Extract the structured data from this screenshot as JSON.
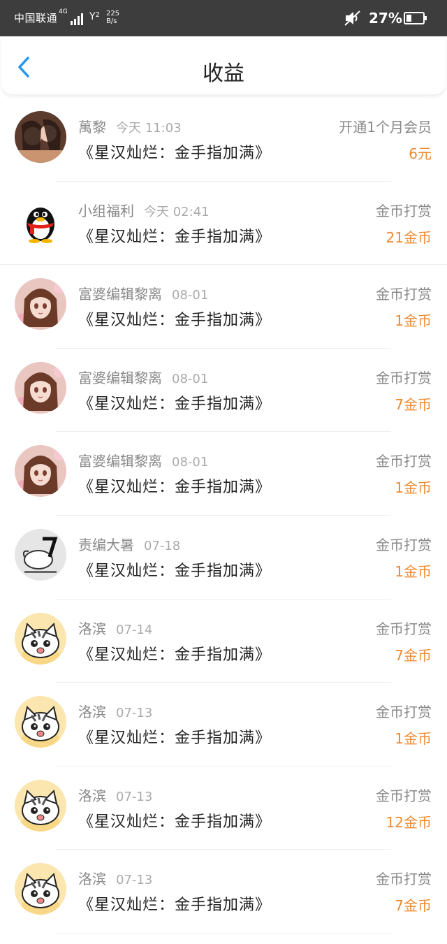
{
  "status_bar": {
    "carrier": "中国联通",
    "network": "4G",
    "wifi_count": "2",
    "speed_value": "225",
    "speed_unit": "B/s",
    "battery_percent": "27%"
  },
  "header": {
    "title": "收益"
  },
  "colors": {
    "accent": "#2196f3",
    "amount": "#f0892f",
    "status_bar_bg": "#3d3d3d"
  },
  "earnings": [
    {
      "user": "萬黎",
      "time": "今天 11:03",
      "book": "《星汉灿烂：金手指加满》",
      "type": "开通1个月会员",
      "amount": "6元",
      "avatar": "photo-avatar"
    },
    {
      "user": "小组福利",
      "time": "今天 02:41",
      "book": "《星汉灿烂：金手指加满》",
      "type": "金币打赏",
      "amount": "21金币",
      "avatar": "qq-penguin-avatar"
    },
    {
      "user": "富婆编辑黎离",
      "time": "08-01",
      "book": "《星汉灿烂：金手指加满》",
      "type": "金币打赏",
      "amount": "1金币",
      "avatar": "anime-girl-avatar"
    },
    {
      "user": "富婆编辑黎离",
      "time": "08-01",
      "book": "《星汉灿烂：金手指加满》",
      "type": "金币打赏",
      "amount": "7金币",
      "avatar": "anime-girl-avatar"
    },
    {
      "user": "富婆编辑黎离",
      "time": "08-01",
      "book": "《星汉灿烂：金手指加满》",
      "type": "金币打赏",
      "amount": "1金币",
      "avatar": "anime-girl-avatar"
    },
    {
      "user": "责编大暑",
      "time": "07-18",
      "book": "《星汉灿烂：金手指加满》",
      "type": "金币打赏",
      "amount": "1金币",
      "avatar": "sketch-avatar"
    },
    {
      "user": "洛滨",
      "time": "07-14",
      "book": "《星汉灿烂：金手指加满》",
      "type": "金币打赏",
      "amount": "7金币",
      "avatar": "cartoon-cat-avatar"
    },
    {
      "user": "洛滨",
      "time": "07-13",
      "book": "《星汉灿烂：金手指加满》",
      "type": "金币打赏",
      "amount": "1金币",
      "avatar": "cartoon-cat-avatar"
    },
    {
      "user": "洛滨",
      "time": "07-13",
      "book": "《星汉灿烂：金手指加满》",
      "type": "金币打赏",
      "amount": "12金币",
      "avatar": "cartoon-cat-avatar"
    },
    {
      "user": "洛滨",
      "time": "07-13",
      "book": "《星汉灿烂：金手指加满》",
      "type": "金币打赏",
      "amount": "7金币",
      "avatar": "cartoon-cat-avatar"
    }
  ]
}
